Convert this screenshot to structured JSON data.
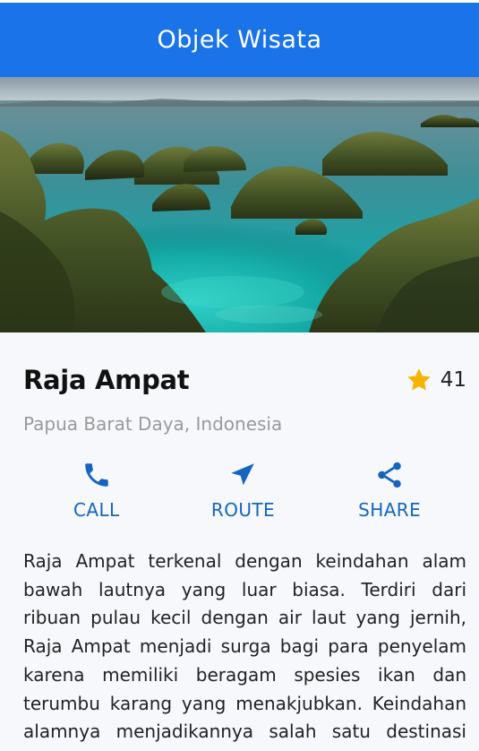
{
  "app_bar": {
    "title": "Objek Wisata"
  },
  "hero": {
    "image_subject": "Raja Ampat karst islands in turquoise sea"
  },
  "place": {
    "name": "Raja Ampat",
    "rating_icon": "star-icon",
    "rating_count": "41",
    "location": "Papua Barat Daya, Indonesia"
  },
  "actions": [
    {
      "icon": "phone-icon",
      "label": "CALL"
    },
    {
      "icon": "navigation-arrow-icon",
      "label": "ROUTE"
    },
    {
      "icon": "share-icon",
      "label": "SHARE"
    }
  ],
  "description": "Raja Ampat terkenal dengan keindahan alam bawah lautnya yang luar biasa. Terdiri dari ribuan pulau kecil dengan air laut yang jernih, Raja Ampat menjadi surga bagi para penyelam karena memiliki beragam spesies ikan dan terumbu karang yang menakjubkan. Keindahan alamnya menjadikannya salah satu destinasi wisata terbaik di dunia.",
  "colors": {
    "primary": "#1a73e8",
    "accent_text": "#1565c0",
    "star": "#f4b400",
    "muted": "#9a9a9a",
    "background": "#f6f8fc"
  }
}
